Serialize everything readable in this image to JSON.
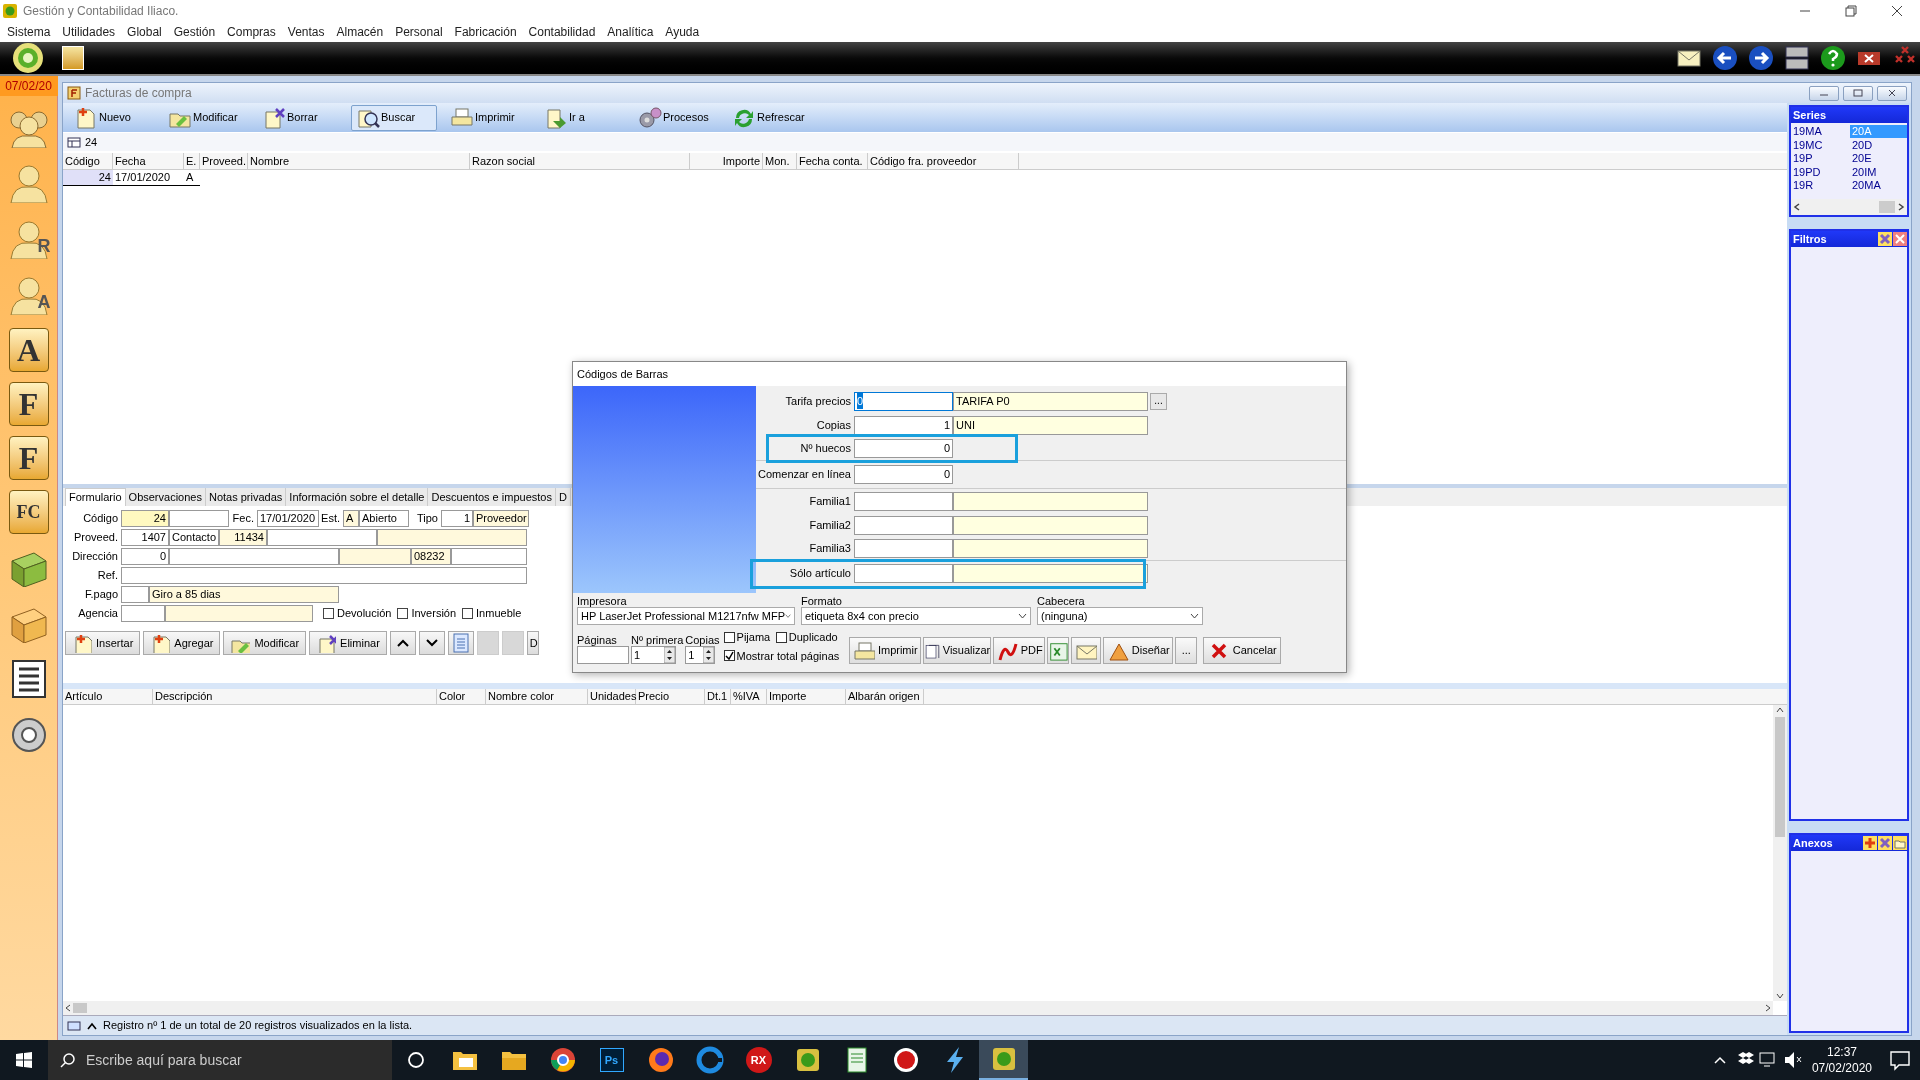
{
  "window": {
    "title": "Gestión y Contabilidad Iliaco."
  },
  "menu": [
    "Sistema",
    "Utilidades",
    "Global",
    "Gestión",
    "Compras",
    "Ventas",
    "Almacén",
    "Personal",
    "Fabricación",
    "Contabilidad",
    "Analítica",
    "Ayuda"
  ],
  "top_tools": [
    {
      "kind": "mail"
    },
    {
      "kind": "back"
    },
    {
      "kind": "forward"
    },
    {
      "kind": "layout"
    },
    {
      "kind": "help"
    },
    {
      "kind": "close"
    },
    {
      "kind": "close-all"
    }
  ],
  "date_badge": "07/02/20",
  "sidebar": [
    {
      "kind": "group"
    },
    {
      "kind": "person"
    },
    {
      "kind": "person",
      "letter": "R"
    },
    {
      "kind": "person",
      "letter": "A"
    },
    {
      "kind": "letter",
      "letter": "A"
    },
    {
      "kind": "letter",
      "letter": "F"
    },
    {
      "kind": "letter",
      "letter": "F"
    },
    {
      "kind": "letter",
      "letter": "FC"
    },
    {
      "kind": "book"
    },
    {
      "kind": "box"
    },
    {
      "kind": "list"
    },
    {
      "kind": "disc"
    }
  ],
  "child": {
    "title": "Facturas de compra",
    "toolbar": [
      {
        "label": "Nuevo",
        "kind": "new",
        "selected": false
      },
      {
        "label": "Modificar",
        "kind": "edit",
        "selected": false
      },
      {
        "label": "Borrar",
        "kind": "delete",
        "selected": false
      },
      {
        "label": "Buscar",
        "kind": "search",
        "selected": true
      },
      {
        "label": "Imprimir",
        "kind": "print",
        "selected": false
      },
      {
        "label": "Ir a",
        "kind": "goto",
        "selected": false
      },
      {
        "label": "Procesos",
        "kind": "gear",
        "selected": false
      },
      {
        "label": "Refrescar",
        "kind": "refresh",
        "selected": false
      }
    ],
    "count": "24",
    "list": {
      "columns": [
        "Código",
        "Fecha",
        "E.",
        "Proveed.",
        "Nombre",
        "Razon social",
        "Importe",
        "Mon.",
        "Fecha conta.",
        "Código fra. proveedor"
      ],
      "rows": [
        {
          "cells": [
            "24",
            "17/01/2020",
            "A"
          ],
          "selected": true
        }
      ]
    },
    "series": {
      "title": "Series",
      "items": [
        {
          "label": "19MA",
          "selected": false
        },
        {
          "label": "19MC",
          "selected": false
        },
        {
          "label": "19P",
          "selected": false
        },
        {
          "label": "19PD",
          "selected": false
        },
        {
          "label": "19R",
          "selected": false
        },
        {
          "label": "20A",
          "selected": true
        },
        {
          "label": "20D",
          "selected": false
        },
        {
          "label": "20E",
          "selected": false
        },
        {
          "label": "20IM",
          "selected": false
        },
        {
          "label": "20MA",
          "selected": false
        }
      ]
    },
    "filters": {
      "title": "Filtros"
    },
    "attachments": {
      "title": "Anexos"
    },
    "form": {
      "tabs": [
        {
          "label": "Formulario",
          "selected": true
        },
        {
          "label": "Observaciones",
          "selected": false
        },
        {
          "label": "Notas privadas",
          "selected": false
        },
        {
          "label": "Información sobre el detalle",
          "selected": false
        },
        {
          "label": "Descuentos e impuestos",
          "selected": false
        },
        {
          "label": "D",
          "selected": false
        }
      ],
      "codigo_label": "Código",
      "codigo": "24",
      "fecha_label": "Fec.",
      "fecha": "17/01/2020",
      "estado_label": "Est.",
      "estado": "A",
      "estado_name": "Abierto",
      "tipo_label": "Tipo",
      "tipo": "1",
      "tipo_name": "Proveedor",
      "proveedor_label": "Proveed.",
      "proveedor": "1407",
      "contacto_label": "Contacto",
      "contacto": "11434",
      "direccion_label": "Dirección",
      "direccion": "0",
      "postal_code": "08232",
      "ref_label": "Ref.",
      "fpago_label": "F.pago",
      "fpago_name": "Giro a 85 dias",
      "agencia_label": "Agencia",
      "checks": [
        {
          "label": "Devolución",
          "checked": false
        },
        {
          "label": "Inversión",
          "checked": false
        },
        {
          "label": "Inmueble",
          "checked": false
        }
      ],
      "actions": [
        {
          "kind": "insert",
          "label": "Insertar"
        },
        {
          "kind": "insert",
          "label": "Agregar"
        },
        {
          "kind": "edit",
          "label": "Modificar"
        },
        {
          "kind": "delete",
          "label": "Eliminar"
        },
        {
          "kind": "up"
        },
        {
          "kind": "down"
        },
        {
          "kind": "doc"
        },
        {
          "kind": "blank"
        },
        {
          "kind": "blank"
        },
        {
          "kind": "cut",
          "label": "D"
        }
      ]
    },
    "lines": {
      "columns": [
        "Artículo",
        "Descripción",
        "Color",
        "Nombre color",
        "Unidades",
        "Precio",
        "Dt.1",
        "%IVA",
        "Importe",
        "Albarán origen"
      ]
    },
    "status": "Registro nº 1 de un total de 20 registros visualizados en la lista."
  },
  "dialog": {
    "title": "Códigos de Barras",
    "fields": [
      {
        "label": "Tarifa precios",
        "value": "0",
        "name": "TARIFA P0",
        "kind": "lookup",
        "button": "...",
        "focused": true,
        "highlighted": false
      },
      {
        "label": "Copias",
        "value": "1",
        "name": "UNI",
        "kind": "pair",
        "focused": false,
        "highlighted": false
      },
      {
        "label": "Nº huecos",
        "value": "0",
        "kind": "number",
        "focused": false,
        "highlighted": true
      },
      {
        "label": "Comenzar en línea",
        "value": "0",
        "kind": "number",
        "focused": false,
        "highlighted": false
      },
      {
        "label": "Familia1",
        "kind": "pair",
        "focused": false,
        "highlighted": false
      },
      {
        "label": "Familia2",
        "kind": "pair",
        "focused": false,
        "highlighted": false
      },
      {
        "label": "Familia3",
        "kind": "pair",
        "focused": false,
        "highlighted": false
      },
      {
        "label": "Sólo artículo",
        "kind": "pair",
        "focused": false,
        "highlighted": true
      }
    ],
    "printer_label": "Impresora",
    "printer": "HP LaserJet Professional M1217nfw MFP",
    "format_label": "Formato",
    "format": "etiqueta 8x4 con precio",
    "header_label": "Cabecera",
    "header": "(ninguna)",
    "pages_label": "Páginas",
    "first_label": "Nº primera",
    "first": "1",
    "copies_label": "Copias",
    "copies": "1",
    "checks": [
      {
        "label": "Pijama",
        "checked": false
      },
      {
        "label": "Duplicado",
        "checked": false
      },
      {
        "label": "Mostrar total páginas",
        "checked": true
      }
    ],
    "buttons": [
      {
        "kind": "print",
        "label": "Imprimir"
      },
      {
        "kind": "preview",
        "label": "Visualizar"
      },
      {
        "kind": "pdf",
        "label": "PDF"
      },
      {
        "kind": "excel"
      },
      {
        "kind": "mail"
      },
      {
        "kind": "design",
        "label": "Diseñar"
      },
      {
        "kind": "more",
        "label": "..."
      },
      {
        "kind": "cancel",
        "label": "Cancelar"
      }
    ]
  },
  "taskbar": {
    "search_placeholder": "Escribe aquí para buscar",
    "apps": [
      {
        "kind": "mailfolder",
        "selected": false
      },
      {
        "kind": "folder",
        "selected": false
      },
      {
        "kind": "chrome",
        "selected": false
      },
      {
        "kind": "ps",
        "text": "Ps",
        "selected": false
      },
      {
        "kind": "firefox",
        "selected": false
      },
      {
        "kind": "edge",
        "selected": false
      },
      {
        "kind": "rx",
        "text": "RX",
        "selected": false
      },
      {
        "kind": "app",
        "selected": false
      },
      {
        "kind": "notepad",
        "selected": false
      },
      {
        "kind": "redapp",
        "selected": false
      },
      {
        "kind": "flash",
        "selected": false
      },
      {
        "kind": "app",
        "selected": true
      }
    ],
    "time": "12:37",
    "date": "07/02/2020"
  }
}
